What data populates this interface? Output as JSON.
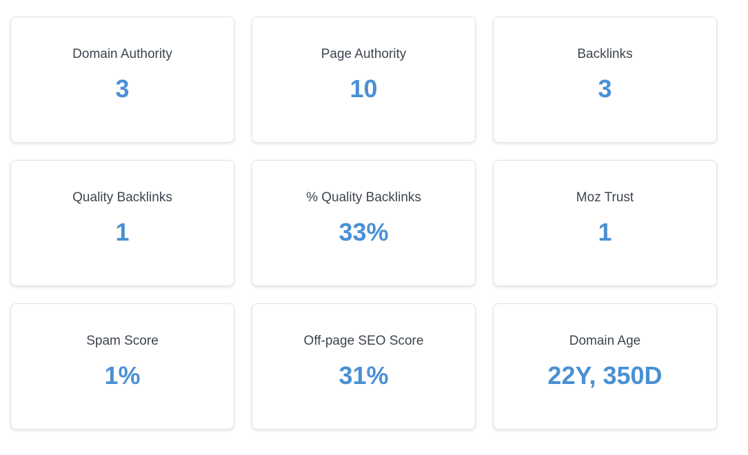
{
  "colors": {
    "value": "#4a90d4",
    "label": "#3d4450",
    "card_border": "#e3e3e3",
    "background": "#ffffff"
  },
  "metrics": [
    {
      "label": "Domain Authority",
      "value": "3"
    },
    {
      "label": "Page Authority",
      "value": "10"
    },
    {
      "label": "Backlinks",
      "value": "3"
    },
    {
      "label": "Quality Backlinks",
      "value": "1"
    },
    {
      "label": "% Quality Backlinks",
      "value": "33%"
    },
    {
      "label": "Moz Trust",
      "value": "1"
    },
    {
      "label": "Spam Score",
      "value": "1%"
    },
    {
      "label": "Off-page SEO Score",
      "value": "31%"
    },
    {
      "label": "Domain Age",
      "value": "22Y, 350D"
    }
  ]
}
